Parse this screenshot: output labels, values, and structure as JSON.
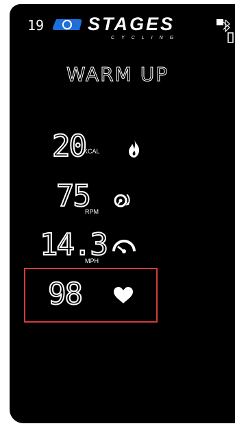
{
  "header": {
    "top_left_number": "19",
    "brand_word": "STAGES",
    "brand_sub": "CYCLING"
  },
  "screen": {
    "title": "WARM UP"
  },
  "metrics": [
    {
      "value": "20",
      "unit": "KCAL",
      "icon": "flame-icon"
    },
    {
      "value": "75",
      "unit": "RPM",
      "icon": "cadence-icon"
    },
    {
      "value": "14.3",
      "unit": "MPH",
      "icon": "speedometer-icon"
    },
    {
      "value": "98",
      "unit": "",
      "icon": "heart-icon"
    }
  ],
  "colors": {
    "background": "#000000",
    "foreground": "#ffffff",
    "highlight": "#d93a3a",
    "accent": "#1e6fd9"
  }
}
